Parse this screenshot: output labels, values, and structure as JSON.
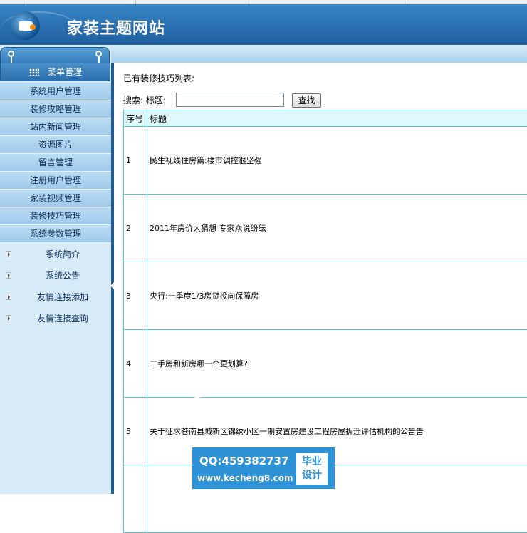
{
  "header": {
    "title": "家装主题网站"
  },
  "sidebar": {
    "menu_title": "菜单管理",
    "items": [
      {
        "label": "系统用户管理"
      },
      {
        "label": "装修攻略管理"
      },
      {
        "label": "站内新闻管理"
      },
      {
        "label": "资源图片"
      },
      {
        "label": "留言管理"
      },
      {
        "label": "注册用户管理"
      },
      {
        "label": "家装视频管理"
      },
      {
        "label": "装修技巧管理"
      },
      {
        "label": "系统参数管理"
      }
    ],
    "sub_items": [
      {
        "label": "系统简介"
      },
      {
        "label": "系统公告"
      },
      {
        "label": "友情连接添加"
      },
      {
        "label": "友情连接查询"
      }
    ]
  },
  "main": {
    "list_title": "已有装修技巧列表:",
    "search": {
      "label": "搜索: 标题:",
      "value": "",
      "button": "查找"
    },
    "table": {
      "headers": [
        "序号",
        "标题"
      ],
      "rows": [
        {
          "no": "1",
          "title": "民生视线住房篇:楼市调控很坚强"
        },
        {
          "no": "2",
          "title": "2011年房价大猜想 专家众说纷纭"
        },
        {
          "no": "3",
          "title": "央行:一季度1/3房贷投向保障房"
        },
        {
          "no": "4",
          "title": "二手房和新房哪一个更划算?"
        },
        {
          "no": "5",
          "title": "关于征求苍南县城新区锦绣小区一期安置房建设工程房屋拆迁评估机构的公告告"
        }
      ]
    }
  },
  "watermark": {
    "qq": "QQ:459382737",
    "url": "www.kecheng8.com",
    "badge_line1": "毕业",
    "badge_line2": "设计"
  }
}
